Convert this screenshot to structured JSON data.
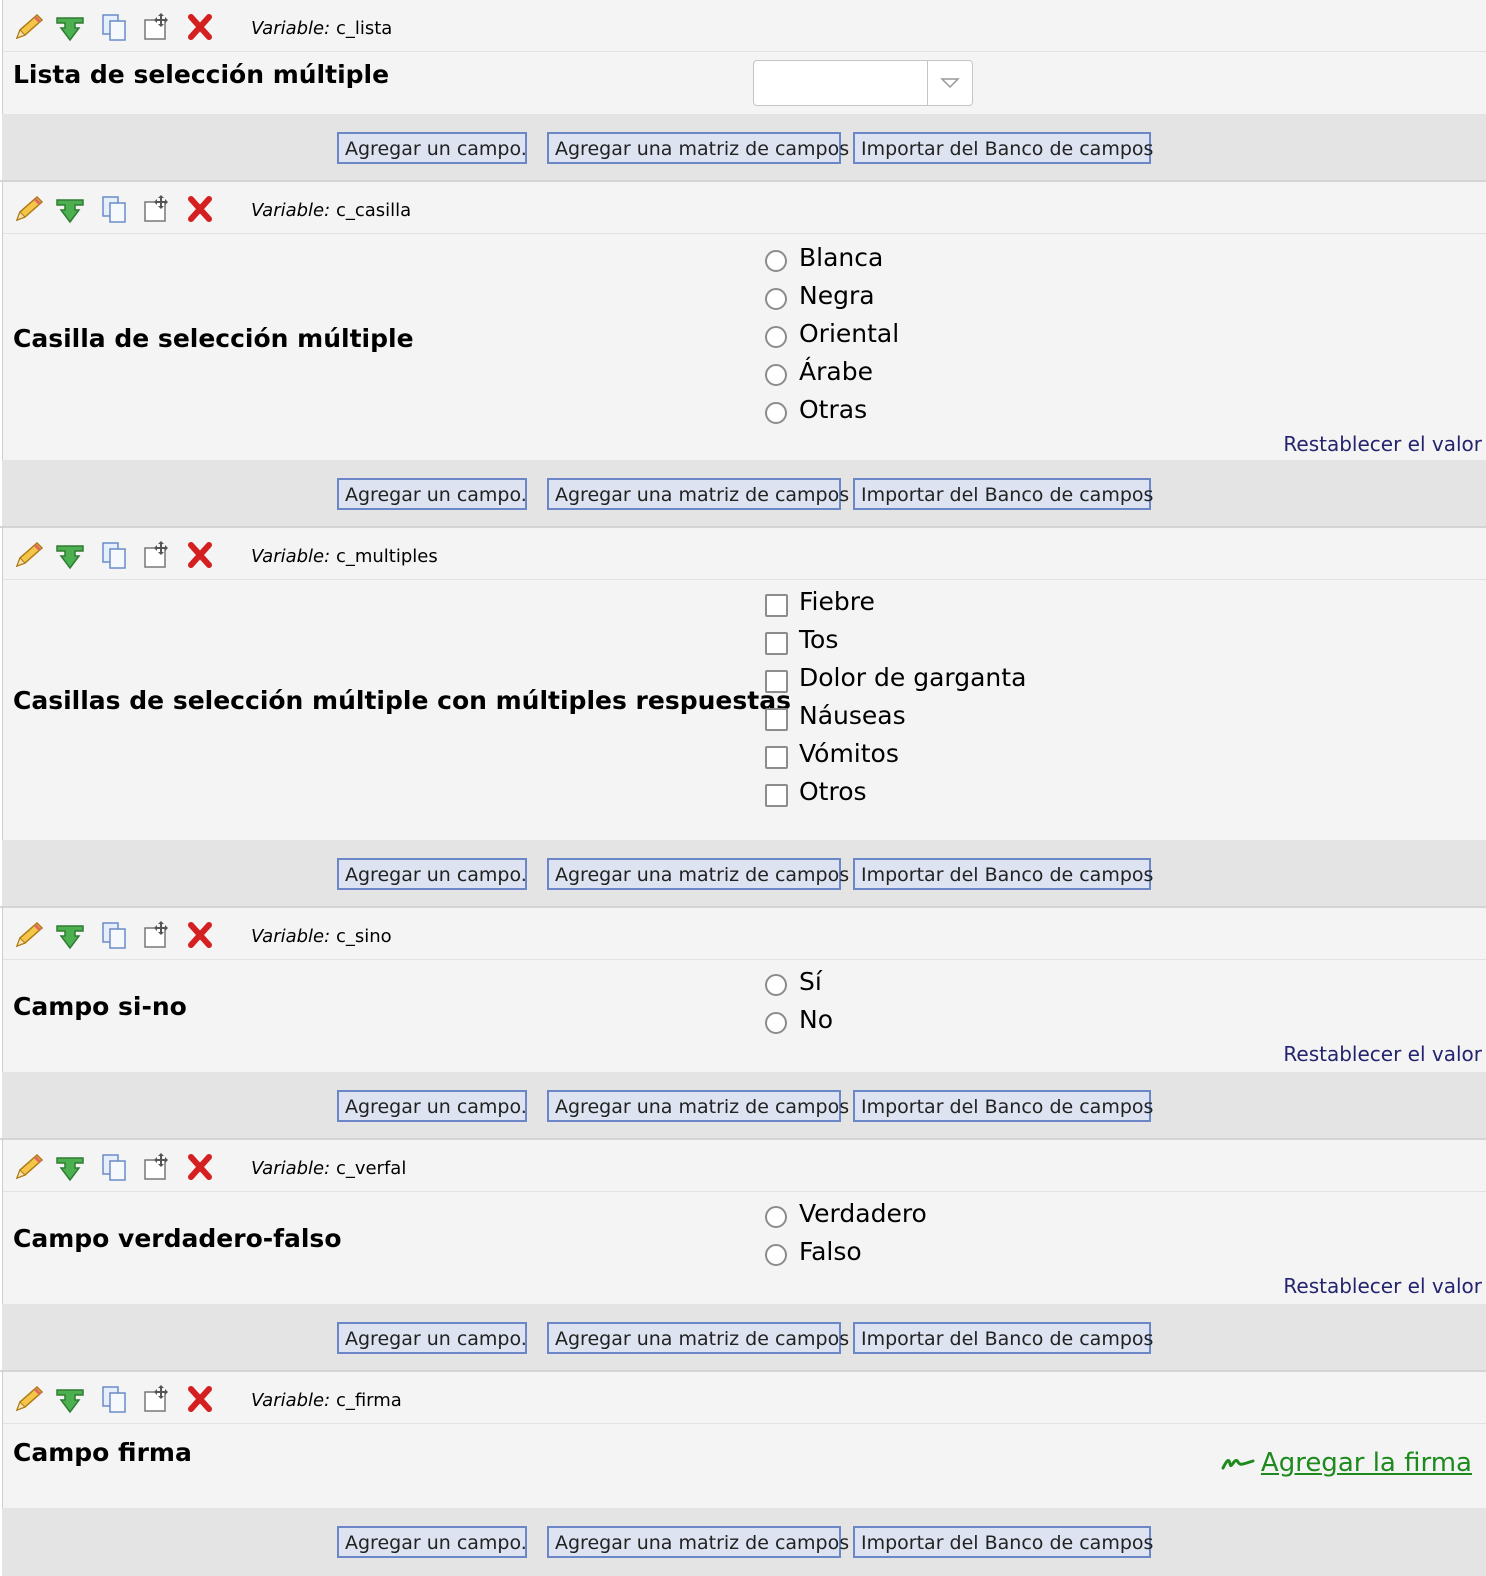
{
  "buttons": {
    "add_field": "Agregar un campo.",
    "add_matrix": "Agregar una matriz de campos",
    "import_bank": "Importar del Banco de campos"
  },
  "variable_prefix": "Variable:",
  "reset_label": "Restablecer el valor",
  "fields": [
    {
      "variable": "c_lista",
      "label": "Lista de selección múltiple",
      "type": "dropdown",
      "value": ""
    },
    {
      "variable": "c_casilla",
      "label": "Casilla de selección múltiple",
      "type": "radio",
      "options": [
        "Blanca",
        "Negra",
        "Oriental",
        "Árabe",
        "Otras"
      ]
    },
    {
      "variable": "c_multiples",
      "label": "Casillas de selección múltiple con múltiples respuestas",
      "type": "checkbox",
      "options": [
        "Fiebre",
        "Tos",
        "Dolor de garganta",
        "Náuseas",
        "Vómitos",
        "Otros"
      ]
    },
    {
      "variable": "c_sino",
      "label": "Campo si-no",
      "type": "radio",
      "options": [
        "Sí",
        "No"
      ]
    },
    {
      "variable": "c_verfal",
      "label": "Campo verdadero-falso",
      "type": "radio",
      "options": [
        "Verdadero",
        "Falso"
      ]
    },
    {
      "variable": "c_firma",
      "label": "Campo firma",
      "type": "signature",
      "action": "Agregar la firma"
    }
  ],
  "colors": {
    "field_bg": "#f4f4f4",
    "button_bar_bg": "#e4e4e4",
    "button_border": "#6b87c8",
    "reset_link": "#23236e",
    "signature_link": "#1e8a1e",
    "delete_icon": "#d42020"
  },
  "icons": [
    "pencil-icon",
    "branch-icon",
    "copy-icon",
    "move-icon",
    "delete-icon"
  ]
}
